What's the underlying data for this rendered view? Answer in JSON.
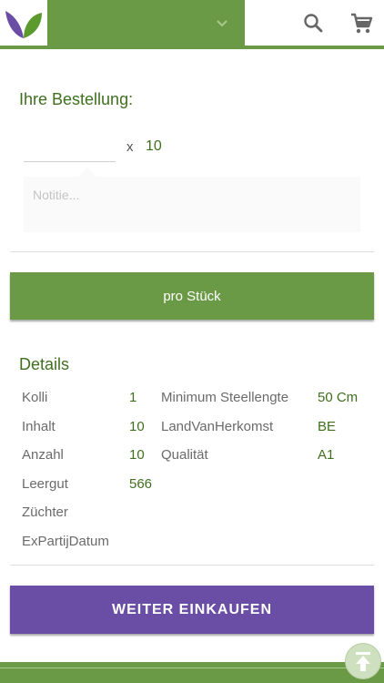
{
  "colors": {
    "accent_green": "#6a9a46",
    "text_green": "#3f6f1f",
    "purple": "#6a4ea5"
  },
  "header": {
    "logo_icon": "leaf-logo",
    "dropdown_icon": "chevron-down-icon",
    "search_icon": "search-icon",
    "cart_icon": "cart-icon"
  },
  "order": {
    "title": "Ihre Bestellung:",
    "quantity_value": "",
    "multiplier": "x",
    "pack_size": "10",
    "note_placeholder": "Notitie..."
  },
  "price_button": {
    "label": "pro Stück"
  },
  "details": {
    "title": "Details",
    "left": [
      {
        "label": "Kolli",
        "value": "1"
      },
      {
        "label": "Inhalt",
        "value": "10"
      },
      {
        "label": "Anzahl",
        "value": "10"
      },
      {
        "label": "Leergut",
        "value": "566"
      },
      {
        "label": "Züchter",
        "value": ""
      },
      {
        "label": "ExPartijDatum",
        "value": ""
      }
    ],
    "right": [
      {
        "label": "Minimum Steellengte",
        "value": "50 Cm"
      },
      {
        "label": "LandVanHerkomst",
        "value": "BE"
      },
      {
        "label": "Qualität",
        "value": "A1"
      }
    ]
  },
  "continue_button": {
    "label": "WEITER EINKAUFEN"
  },
  "scroll_top": {
    "icon": "arrow-up-icon"
  }
}
